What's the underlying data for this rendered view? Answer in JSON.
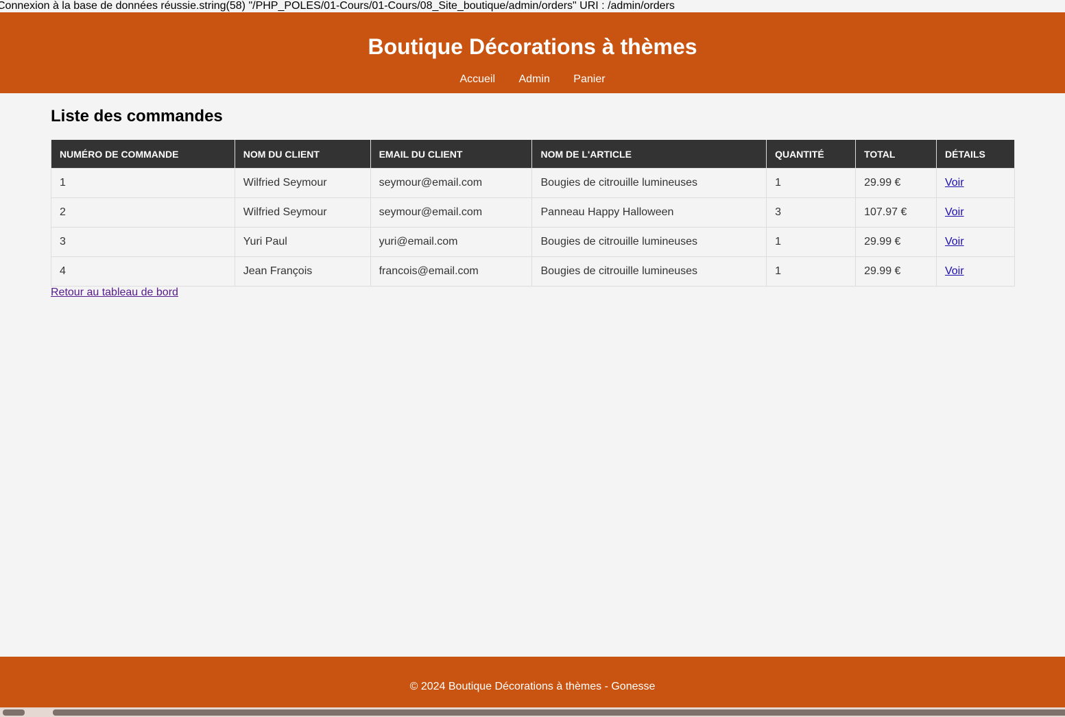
{
  "debug_output": "Connexion à la base de données réussie.string(58) \"/PHP_POLES/01-Cours/01-Cours/08_Site_boutique/admin/orders\" URI : /admin/orders",
  "header": {
    "title": "Boutique Décorations à thèmes",
    "nav": [
      {
        "label": "Accueil"
      },
      {
        "label": "Admin"
      },
      {
        "label": "Panier"
      }
    ]
  },
  "main": {
    "heading": "Liste des commandes",
    "table": {
      "columns": [
        "Numéro de commande",
        "Nom du client",
        "Email du client",
        "Nom de l'article",
        "Quantité",
        "Total",
        "Détails"
      ],
      "rows": [
        {
          "id": "1",
          "client": "Wilfried Seymour",
          "email": "seymour@email.com",
          "article": "Bougies de citrouille lumineuses",
          "quantity": "1",
          "total": "29.99 €",
          "details": "Voir"
        },
        {
          "id": "2",
          "client": "Wilfried Seymour",
          "email": "seymour@email.com",
          "article": "Panneau Happy Halloween",
          "quantity": "3",
          "total": "107.97 €",
          "details": "Voir"
        },
        {
          "id": "3",
          "client": "Yuri Paul",
          "email": "yuri@email.com",
          "article": "Bougies de citrouille lumineuses",
          "quantity": "1",
          "total": "29.99 €",
          "details": "Voir"
        },
        {
          "id": "4",
          "client": "Jean François",
          "email": "francois@email.com",
          "article": "Bougies de citrouille lumineuses",
          "quantity": "1",
          "total": "29.99 €",
          "details": "Voir"
        }
      ]
    },
    "back_link": "Retour au tableau de bord"
  },
  "footer": {
    "text": "© 2024 Boutique Décorations à thèmes - Gonesse"
  },
  "colors": {
    "brand": "#c95411",
    "table_header_bg": "#333333",
    "page_bg": "#f4f4f4",
    "link": "#1a0dab",
    "visited_link": "#551a8b"
  }
}
